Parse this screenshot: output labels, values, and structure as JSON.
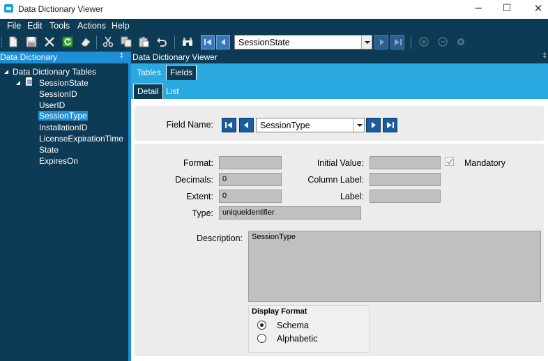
{
  "window": {
    "title": "Data Dictionary Viewer",
    "minimize": "─",
    "maximize": "☐",
    "close": "✕"
  },
  "menu": [
    "File",
    "Edit",
    "Tools",
    "Actions",
    "Help"
  ],
  "toolbar": {
    "table_combo_value": "SessionState"
  },
  "left_panel": {
    "title": "Data Dictionary",
    "pin": "‡",
    "tree": {
      "root": "Data Dictionary Tables",
      "table": "SessionState",
      "fields": [
        "SessionID",
        "UserID",
        "SessionType",
        "InstallationID",
        "LicenseExpirationTime",
        "State",
        "ExpiresOn"
      ],
      "selected_field": "SessionType"
    }
  },
  "right_panel": {
    "title": "Data Dictionary Viewer",
    "pin": "‡",
    "tabs": [
      "Tables",
      "Fields"
    ],
    "active_tab": "Fields",
    "subtabs": [
      "Detail",
      "List"
    ],
    "active_subtab": "Detail"
  },
  "detail": {
    "field_name_label": "Field Name:",
    "field_name_value": "SessionType",
    "format_label": "Format:",
    "format_value": "",
    "decimals_label": "Decimals:",
    "decimals_value": "0",
    "extent_label": "Extent:",
    "extent_value": "0",
    "type_label": "Type:",
    "type_value": "uniqueidentifier",
    "initial_value_label": "Initial Value:",
    "initial_value_value": "",
    "column_label_label": "Column Label:",
    "column_label_value": "",
    "label_label": "Label:",
    "label_value": "",
    "mandatory_label": "Mandatory",
    "mandatory_checked": true,
    "description_label": "Description:",
    "description_value": "SessionType",
    "display_format": {
      "title": "Display Format",
      "options": [
        "Schema",
        "Alphabetic"
      ],
      "selected": "Schema"
    }
  },
  "colors": {
    "dark_navy": "#0d3b55",
    "accent_blue": "#1e8fd5",
    "tab_strip": "#2aa8e0",
    "nav_button": "#1b5c9e"
  }
}
